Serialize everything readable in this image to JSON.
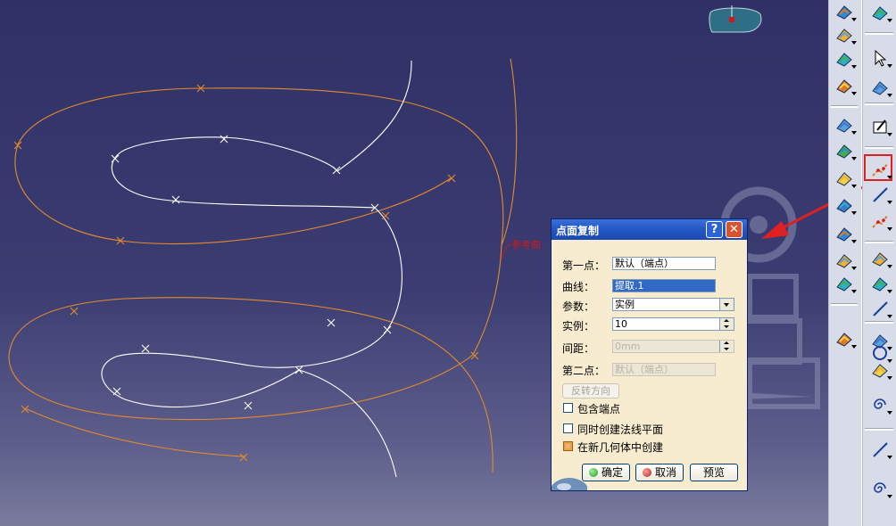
{
  "viewport": {
    "sketch_label": "参考曲",
    "colors": {
      "background_top": "#2f3166",
      "background_bottom": "#7a7b9c",
      "orange_curve": "#e58a2b",
      "white_curve": "#ffffff",
      "label_red": "#d01818"
    }
  },
  "toolbar": {
    "highlight_color": "#e02020",
    "left_icons": [
      "sweep-icon",
      "blend-icon",
      "multi-section-icon",
      "fill-icon",
      "boundary-icon",
      "join-icon",
      "extract-icon",
      "translate-icon",
      "extrapolate-icon",
      "split-icon",
      "offset-icon",
      "healing-icon"
    ],
    "right_icons": [
      "properties-icon",
      "select-arrow-icon",
      "snap-icon",
      "sketcher-icon",
      "point-repetition-icon",
      "line-icon",
      "plane-repetition-icon",
      "point-icon",
      "curve-icon",
      "spline-icon",
      "axis-icon",
      "circle-icon",
      "corner-icon",
      "spiral-icon",
      "polyline-icon",
      "helix-icon"
    ]
  },
  "dialog": {
    "title": "点面复制",
    "help_label": "?",
    "close_label": "✕",
    "first_point_label": "第一点：",
    "first_point_value": "默认（端点）",
    "curve_label": "曲线：",
    "curve_value": "提取.1",
    "parameter_label": "参数：",
    "parameter_value": "实例",
    "instances_label": "实例：",
    "instances_value": "10",
    "spacing_label": "间距：",
    "spacing_value": "0mm",
    "second_point_label": "第二点：",
    "second_point_value": "默认（端点）",
    "reverse_button": "反转方向",
    "include_endpoints_label": "包含端点",
    "include_endpoints_checked": false,
    "create_normal_planes_label": "同时创建法线平面",
    "create_normal_planes_checked": false,
    "create_in_new_body_label": "在新几何体中创建",
    "create_in_new_body_checked": true,
    "ok_button": "确定",
    "cancel_button": "取消",
    "preview_button": "预览"
  }
}
